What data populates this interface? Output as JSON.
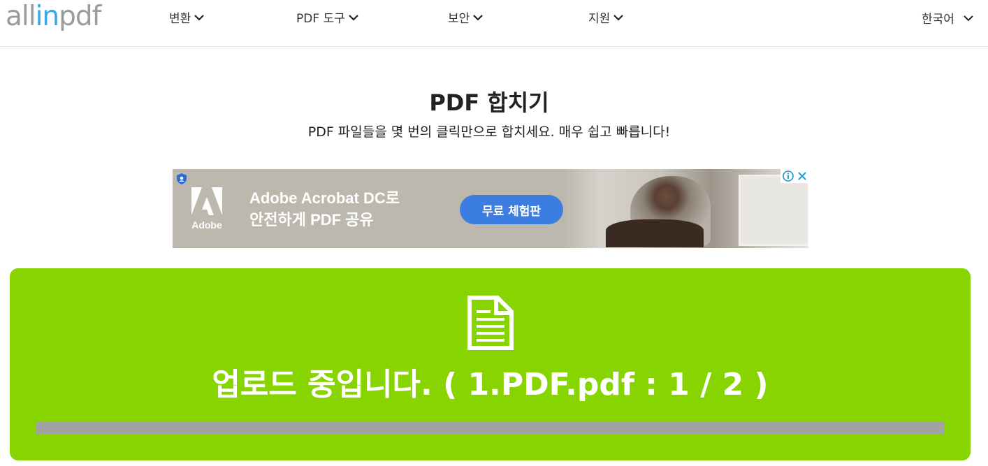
{
  "header": {
    "logo": {
      "part1": "all",
      "part2": "in",
      "part3": "pdf"
    },
    "nav": [
      {
        "label": "변환"
      },
      {
        "label": "PDF 도구"
      },
      {
        "label": "보안"
      },
      {
        "label": "지원"
      }
    ],
    "language": "한국어"
  },
  "main": {
    "title": "PDF 합치기",
    "subtitle": "PDF 파일들을 몇 번의 클릭만으로 합치세요. 매우 쉽고 빠릅니다!"
  },
  "ad": {
    "brand": "Adobe",
    "headline_line1": "Adobe Acrobat DC로",
    "headline_line2": "안전하게 PDF 공유",
    "cta": "무료 체험판",
    "info_icon": "info-icon",
    "close_icon": "close-icon"
  },
  "upload": {
    "status": "업로드 중입니다. ( 1.PDF.pdf : 1 / 2 )",
    "progress": 0,
    "colors": {
      "panel": "#88d400",
      "track": "#a2a2a2"
    }
  }
}
